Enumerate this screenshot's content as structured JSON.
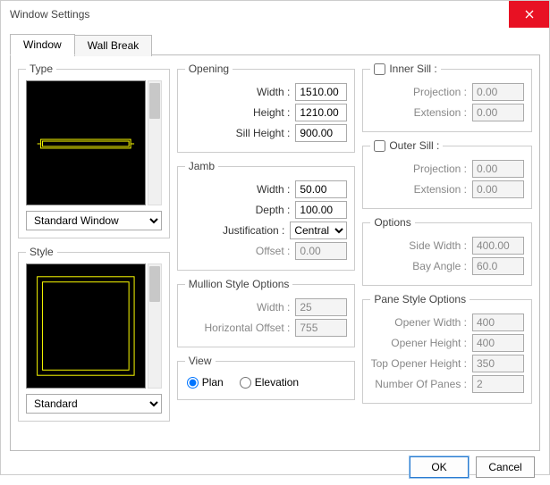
{
  "dialog": {
    "title": "Window Settings"
  },
  "tabs": {
    "window": "Window",
    "wallbreak": "Wall Break"
  },
  "type": {
    "legend": "Type",
    "select": "Standard Window"
  },
  "style": {
    "legend": "Style",
    "select": "Standard"
  },
  "opening": {
    "legend": "Opening",
    "width_label": "Width :",
    "width": "1510.00",
    "height_label": "Height :",
    "height": "1210.00",
    "sill_label": "Sill Height :",
    "sill": "900.00"
  },
  "jamb": {
    "legend": "Jamb",
    "width_label": "Width :",
    "width": "50.00",
    "depth_label": "Depth :",
    "depth": "100.00",
    "justification_label": "Justification :",
    "justification": "Central",
    "offset_label": "Offset :",
    "offset": "0.00"
  },
  "mullion": {
    "legend": "Mullion Style Options",
    "width_label": "Width :",
    "width": "25",
    "hoffset_label": "Horizontal Offset :",
    "hoffset": "755"
  },
  "view": {
    "legend": "View",
    "plan": "Plan",
    "elevation": "Elevation"
  },
  "innersill": {
    "legend": "Inner Sill :",
    "projection_label": "Projection :",
    "projection": "0.00",
    "extension_label": "Extension :",
    "extension": "0.00"
  },
  "outersill": {
    "legend": "Outer Sill :",
    "projection_label": "Projection :",
    "projection": "0.00",
    "extension_label": "Extension :",
    "extension": "0.00"
  },
  "options": {
    "legend": "Options",
    "sidewidth_label": "Side Width :",
    "sidewidth": "400.00",
    "bayangle_label": "Bay Angle :",
    "bayangle": "60.0"
  },
  "pane": {
    "legend": "Pane Style Options",
    "openerw_label": "Opener Width :",
    "openerw": "400",
    "openerh_label": "Opener Height :",
    "openerh": "400",
    "toph_label": "Top Opener Height :",
    "toph": "350",
    "num_label": "Number Of Panes :",
    "num": "2"
  },
  "buttons": {
    "ok": "OK",
    "cancel": "Cancel"
  }
}
